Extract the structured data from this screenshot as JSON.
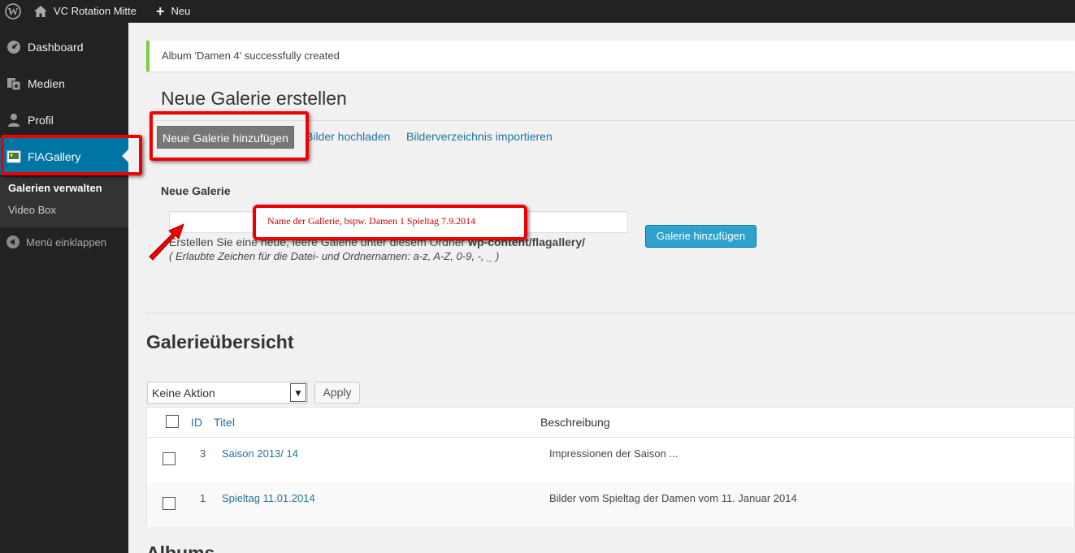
{
  "adminbar": {
    "site_name": "VC Rotation Mitte",
    "new_label": "Neu"
  },
  "sidebar": {
    "items": [
      {
        "label": "Dashboard",
        "icon": "dashboard-icon"
      },
      {
        "label": "Medien",
        "icon": "media-icon"
      },
      {
        "label": "Profil",
        "icon": "user-icon"
      },
      {
        "label": "FlAGallery",
        "icon": "gallery-icon"
      }
    ],
    "submenu": [
      {
        "label": "Galerien verwalten"
      },
      {
        "label": "Video Box"
      }
    ],
    "collapse_label": "Menü einklappen"
  },
  "notice": {
    "text": "Album 'Damen 4' successfully created"
  },
  "create": {
    "title": "Neue Galerie erstellen",
    "tabs": [
      "Neue Galerie hinzufügen",
      "Bilder hochladen",
      "Bilderverzeichnis importieren"
    ],
    "field_label": "Neue Galerie",
    "input_value": "",
    "submit_label": "Galerie hinzufügen",
    "help_prefix": "Erstellen Sie eine neue, leere Galerie unter diesem Ordner",
    "help_path": "wp-content/flagallery/",
    "help_chars": "( Erlaubte Zeichen für die Datei- und Ordnernamen: a-z, A-Z, 0-9, -, _ )"
  },
  "annotation": {
    "callout_text": "Name der Gallerie, bspw. Damen 1 Spieltag 7.9.2014",
    "color": "#e00000"
  },
  "overview": {
    "title": "Galerieübersicht",
    "bulk_action": "Keine Aktion",
    "apply_label": "Apply",
    "columns": {
      "id": "ID",
      "title": "Titel",
      "description": "Beschreibung"
    },
    "rows": [
      {
        "id": "3",
        "title": "Saison 2013/ 14",
        "description": "Impressionen der Saison ..."
      },
      {
        "id": "1",
        "title": "Spieltag 11.01.2014",
        "description": "Bilder vom Spieltag der Damen vom 11. Januar 2014"
      }
    ]
  },
  "albums": {
    "title": "Albums"
  },
  "colors": {
    "accent": "#0074a2",
    "button_primary": "#2ea2cc",
    "link": "#21759b",
    "notice_success": "#7ad03a"
  }
}
